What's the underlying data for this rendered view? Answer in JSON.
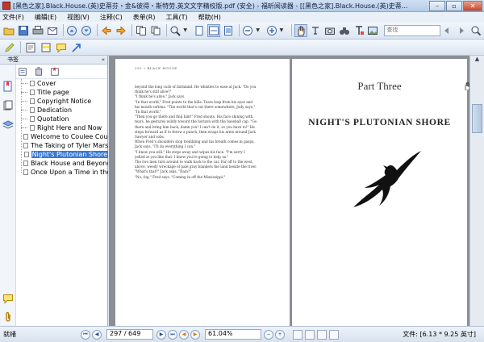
{
  "window": {
    "title": "[黑色之家].Black.House.(英)史蒂芬・金&彼得・斯特劳.英文文字精校版.pdf (安全) - 福昕阅读器 - [[黑色之家].Black.House.(英)史蒂...",
    "min_label": "–",
    "max_label": "▫",
    "close_label": "✕"
  },
  "menu": {
    "items": [
      "文件(F)",
      "编辑(E)",
      "视图(V)",
      "注释(C)",
      "表单(R)",
      "工具(T)",
      "帮助(H)"
    ]
  },
  "toolbar": {
    "search_placeholder": "查找"
  },
  "sidebar": {
    "header": "书签",
    "collapse_label": "«",
    "bookmarks": [
      {
        "label": "Cover",
        "selected": false
      },
      {
        "label": "Title page",
        "selected": false
      },
      {
        "label": "Copyright Notice",
        "selected": false
      },
      {
        "label": "Dedication",
        "selected": false
      },
      {
        "label": "Quotation",
        "selected": false
      },
      {
        "label": "Right Here and Now",
        "selected": false
      },
      {
        "label": "Welcome to Coulee Country",
        "selected": false
      },
      {
        "label": "The Taking of Tyler Marshall",
        "selected": false
      },
      {
        "label": "Night's Plutonian Shore",
        "selected": true
      },
      {
        "label": "Black House and Beyond",
        "selected": false
      },
      {
        "label": "Once Upon a Time in the T",
        "selected": false
      }
    ]
  },
  "document": {
    "left_page": {
      "running_head": "292 • BLACK HOUSE",
      "lines": [
        "beyond the long curb of farmland. He whistles to ease at Jack. \"Do you",
        "think he's still alive?\"",
        "\"I think he's alive,\" Jack says.",
        "\"In that world,\" Fred points to the hills. Tears leap from his eyes and",
        "his mouth softens. \"The world that's out there somewhere, Judy says.\"",
        "\"In that world.\"",
        "\"Then you go there and find him!\" Fred shouts. His face shining with",
        "tears, he gestures wildly toward the horizon with the baseball cap. \"Go",
        "there and bring him back, damn you! I can't do it, so you have to!\" He",
        "steps forward as if to throw a punch, then wraps his arms around Jack",
        "Sawyer and sobs.",
        "When Fred's shoulders stop trembling and his breath comes in gasps,",
        "Jack says, \"I'll do everything I can.\"",
        "\"I know you will.\" He steps away and wipes his face. \"I'm sorry I",
        "yelled at you like that. I know you're going to help us.\"",
        "The two men turn around to walk back to the car. Far off to the west,",
        "above, weedy wreckage of pale gray blankets the land beside the river.",
        "\"What's that?\" Jack asks. \"Rain?\"",
        "\"No, fog,\" Fred says. \"Coming in off the Mississippi.\""
      ]
    },
    "right_page": {
      "part_label": "Part Three",
      "part_title": "NIGHT'S PLUTONIAN SHORE"
    }
  },
  "statusbar": {
    "status": "就绪",
    "page_display": "297 / 649",
    "zoom": "61.04%",
    "doc_size": "文件: [6.13 * 9.25 英寸]"
  },
  "colors": {
    "selection": "#3a78d4",
    "viewer_background": "#8b8f95"
  }
}
